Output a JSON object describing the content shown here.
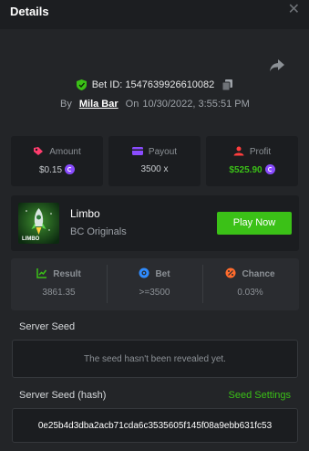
{
  "header": {
    "title": "Details"
  },
  "bet": {
    "id_text": "Bet ID: 1547639926610082",
    "by_label": "By",
    "user": "Mila Bar",
    "on_label": "On",
    "datetime": "10/30/2022, 3:55:51 PM"
  },
  "stats": {
    "amount": {
      "label": "Amount",
      "value": "$0.15"
    },
    "payout": {
      "label": "Payout",
      "value": "3500 x"
    },
    "profit": {
      "label": "Profit",
      "value": "$525.90"
    }
  },
  "game": {
    "name": "Limbo",
    "provider": "BC Originals",
    "thumb_text": "LIMBO",
    "play_label": "Play Now"
  },
  "result": {
    "result": {
      "label": "Result",
      "value": "3861.35"
    },
    "bet": {
      "label": "Bet",
      "value": ">=3500"
    },
    "chance": {
      "label": "Chance",
      "value": "0.03%"
    }
  },
  "seeds": {
    "server_seed_label": "Server Seed",
    "server_seed_text": "The seed hasn't been revealed yet.",
    "hash_label": "Server Seed (hash)",
    "settings_label": "Seed Settings",
    "hash_value": "0e25b4d3dba2acb71cda6c3535605f145f08a9ebb631fc53"
  },
  "colors": {
    "accent_green": "#3bc117",
    "coin_purple": "#8a4cff",
    "background": "#232528",
    "card": "#1b1d20"
  }
}
